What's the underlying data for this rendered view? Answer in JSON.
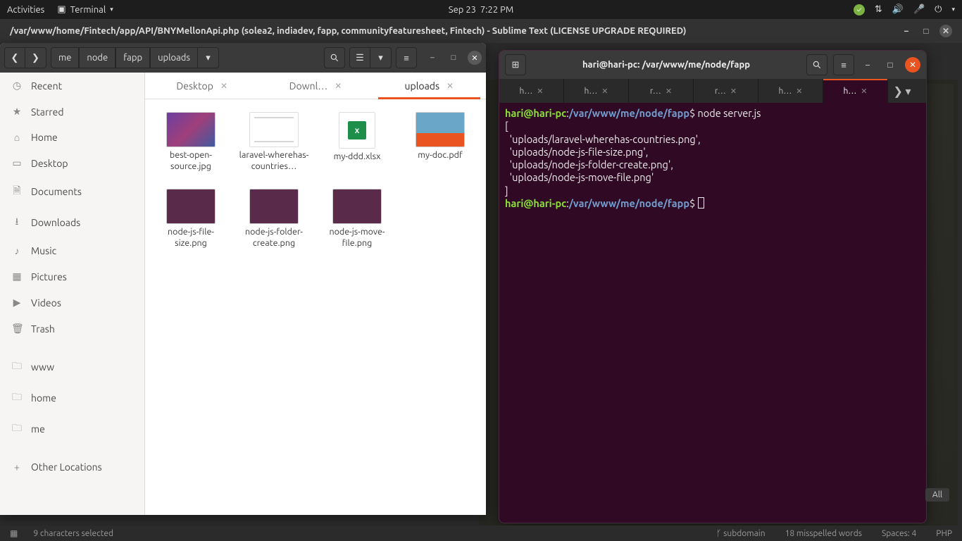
{
  "topbar": {
    "activities": "Activities",
    "app_label": "Terminal",
    "date": "Sep 23",
    "time": "7:22 PM"
  },
  "sublime": {
    "title": "/var/www/home/Fintech/app/API/BNYMellonApi.php (solea2, indiadev, fapp, communityfeaturesheet, Fintech) - Sublime Text (LICENSE UPGRADE REQUIRED)"
  },
  "files": {
    "breadcrumb": [
      "me",
      "node",
      "fapp",
      "uploads"
    ],
    "sidebar": [
      {
        "icon": "clock",
        "label": "Recent"
      },
      {
        "icon": "star",
        "label": "Starred"
      },
      {
        "icon": "home",
        "label": "Home"
      },
      {
        "icon": "desktop",
        "label": "Desktop"
      },
      {
        "icon": "docs",
        "label": "Documents"
      },
      {
        "icon": "down",
        "label": "Downloads"
      },
      {
        "icon": "music",
        "label": "Music"
      },
      {
        "icon": "pics",
        "label": "Pictures"
      },
      {
        "icon": "video",
        "label": "Videos"
      },
      {
        "icon": "trash",
        "label": "Trash"
      }
    ],
    "sidebar2": [
      {
        "icon": "folder",
        "label": "www"
      },
      {
        "icon": "folder",
        "label": "home"
      },
      {
        "icon": "folder",
        "label": "me"
      }
    ],
    "other_locations": "Other Locations",
    "tabs": [
      {
        "label": "Desktop",
        "active": false
      },
      {
        "label": "Downl…",
        "active": false
      },
      {
        "label": "uploads",
        "active": true
      }
    ],
    "items": [
      {
        "name": "best-open-source.jpg",
        "kind": "img1"
      },
      {
        "name": "laravel-wherehas-countries…",
        "kind": "doc"
      },
      {
        "name": "my-ddd.xlsx",
        "kind": "xlsx"
      },
      {
        "name": "my-doc.pdf",
        "kind": "pdf"
      },
      {
        "name": "node-js-file-size.png",
        "kind": "png"
      },
      {
        "name": "node-js-folder-create.png",
        "kind": "png"
      },
      {
        "name": "node-js-move-file.png",
        "kind": "png"
      }
    ]
  },
  "terminal": {
    "title": "hari@hari-pc: /var/www/me/node/fapp",
    "tabs": [
      "h…",
      "h…",
      "r…",
      "r…",
      "h…",
      "h…"
    ],
    "active_tab": 5,
    "prompt_user": "hari@hari-pc",
    "prompt_path": "/var/www/me/node/fapp",
    "cmd": "node server.js",
    "output": [
      "[",
      "  'uploads/laravel-wherehas-countries.png',",
      "  'uploads/node-js-file-size.png',",
      "  'uploads/node-js-folder-create.png',",
      "  'uploads/node-js-move-file.png'",
      "]"
    ]
  },
  "status": {
    "selection": "9 characters selected",
    "branch": "subdomain",
    "spell": "18 misspelled words",
    "spaces": "Spaces: 4",
    "lang": "PHP",
    "find": "All"
  }
}
